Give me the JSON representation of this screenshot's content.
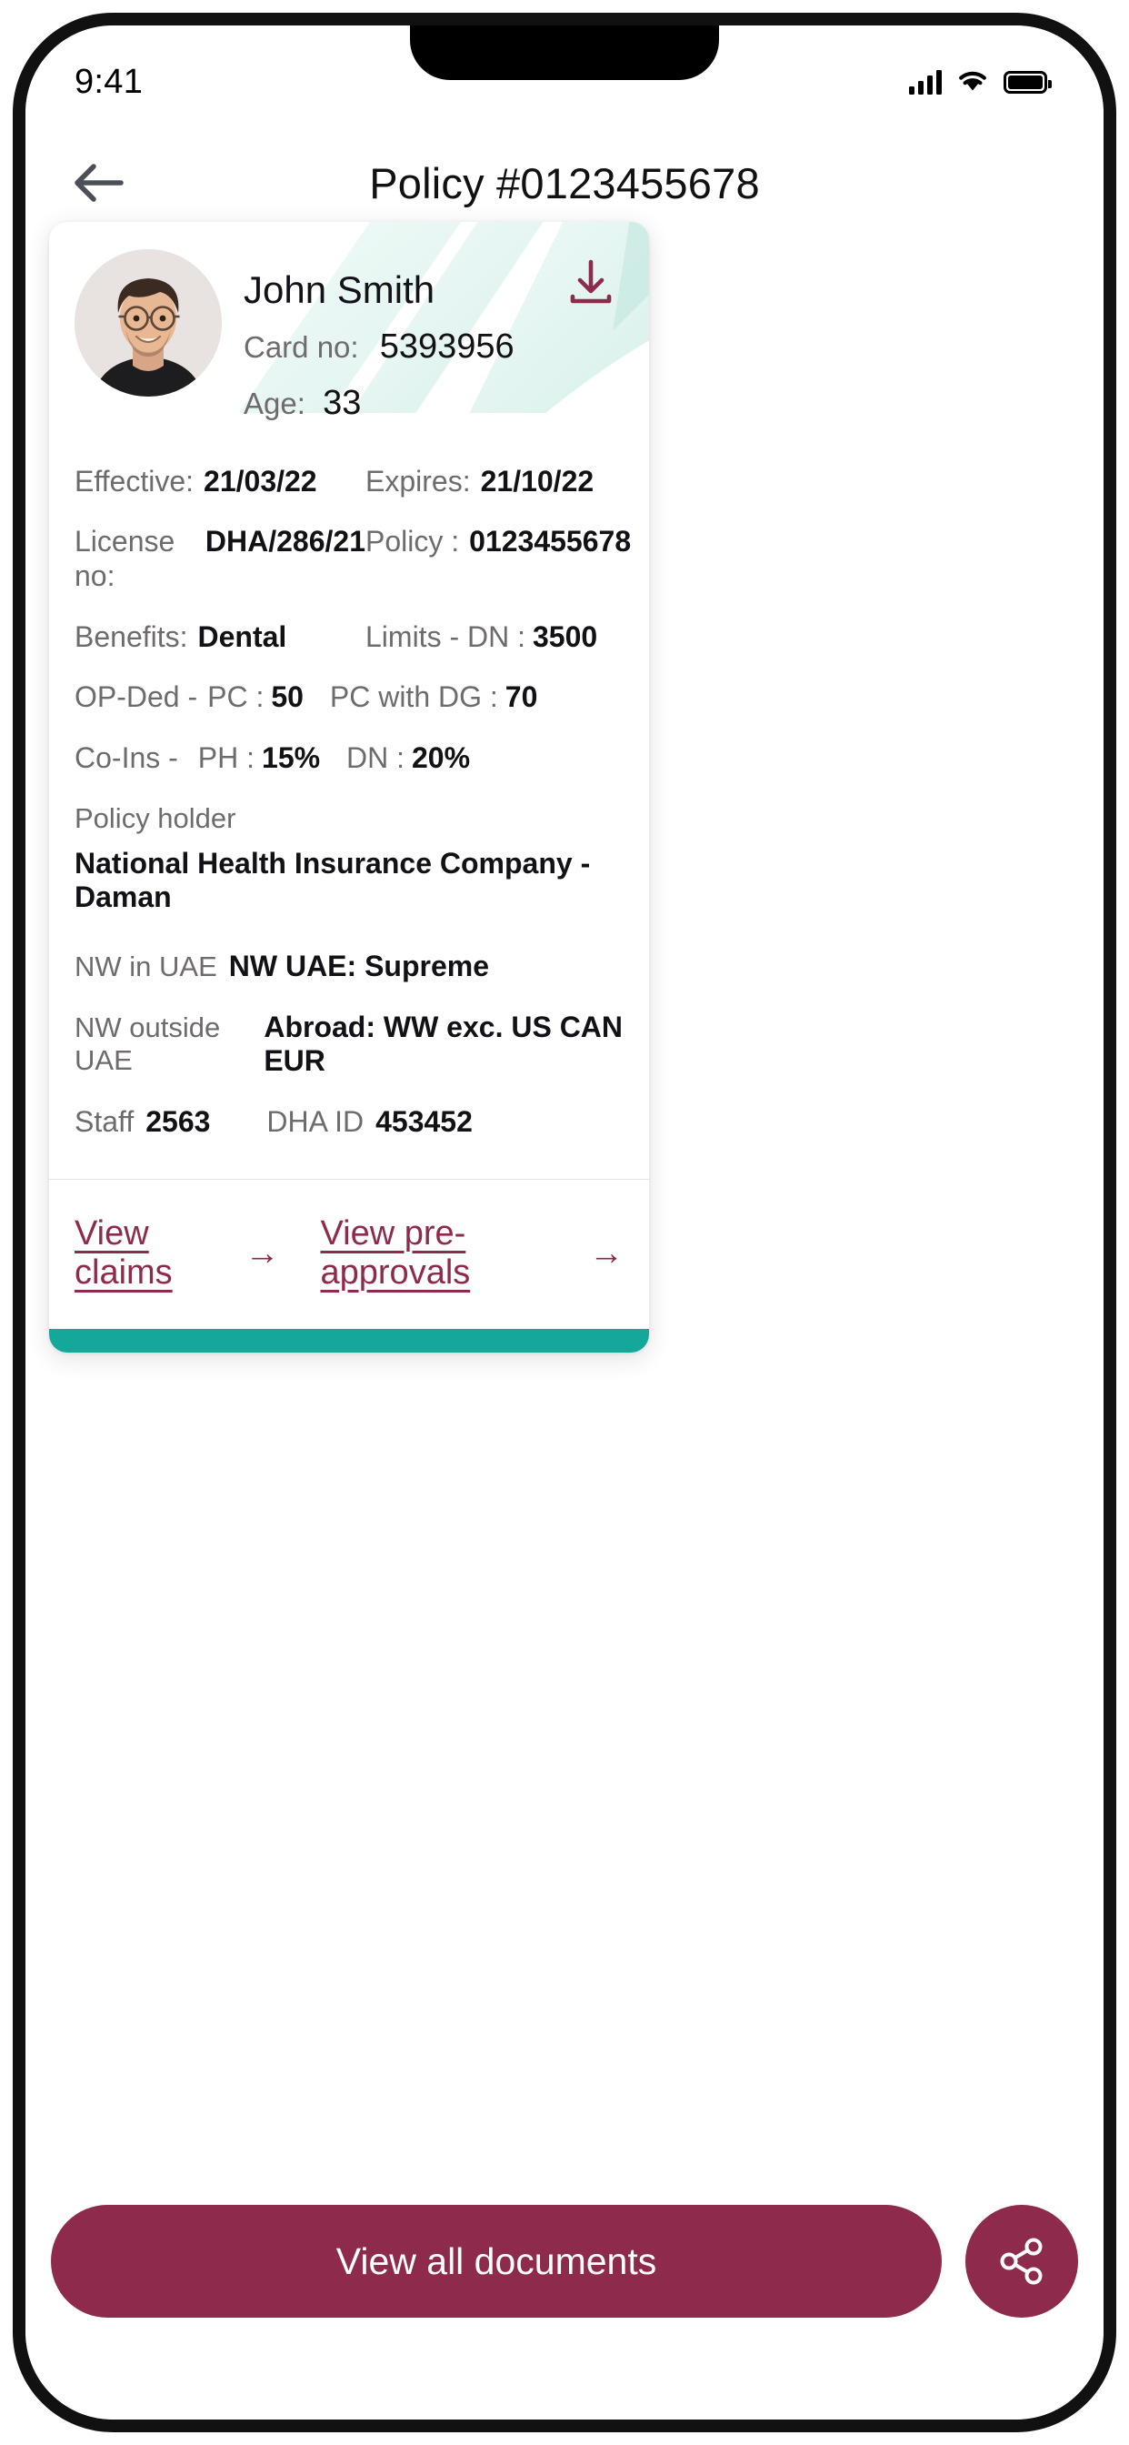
{
  "status_bar": {
    "time": "9:41",
    "signal_icon": "cellular-signal-icon",
    "wifi_icon": "wifi-icon",
    "battery_icon": "battery-icon"
  },
  "nav": {
    "back_icon": "arrow-left-icon",
    "title": "Policy #0123455678"
  },
  "card": {
    "download_icon": "download-icon",
    "avatar_alt": "avatar",
    "holder_name": "John Smith",
    "card_no_label": "Card no:",
    "card_no_value": "5393956",
    "age_label": "Age:",
    "age_value": "33",
    "rows": [
      {
        "label": "Effective:",
        "value": "21/03/22",
        "label2": "Expires:",
        "value2": "21/10/22"
      },
      {
        "label": "License no:",
        "value": "DHA/286/21",
        "label2": "Policy :",
        "value2": "0123455678"
      },
      {
        "label": "Benefits:",
        "value": "Dental",
        "label2": "Limits - DN :",
        "value2": "3500"
      }
    ],
    "op_ded": {
      "label": "OP-Ded -",
      "item1_label": "PC :",
      "item1_value": "50",
      "item2_label": "PC with DG :",
      "item2_value": "70"
    },
    "co_ins": {
      "label": "Co-Ins -",
      "item1_label": "PH :",
      "item1_value": "15%",
      "item2_label": "DN :",
      "item2_value": "20%"
    },
    "policy_holder": {
      "label": "Policy holder",
      "value": "National Health Insurance Company - Daman"
    },
    "nw_in_uae": {
      "label": "NW in UAE",
      "value": "NW UAE: Supreme"
    },
    "nw_outside_uae": {
      "label": "NW outside UAE",
      "value": "Abroad: WW exc. US CAN EUR"
    },
    "staff": {
      "label": "Staff",
      "value": "2563"
    },
    "dha_id": {
      "label": "DHA ID",
      "value": "453452"
    },
    "links": [
      {
        "label": "View claims",
        "arrow": "→"
      },
      {
        "label": "View pre-approvals",
        "arrow": "→"
      }
    ]
  },
  "actions": {
    "primary_label": "View all documents",
    "share_icon": "share-icon"
  },
  "colors": {
    "accent": "#8E2A4C",
    "teal": "#14A79A",
    "label_grey": "#6E6A6D",
    "text_dark": "#111116"
  }
}
